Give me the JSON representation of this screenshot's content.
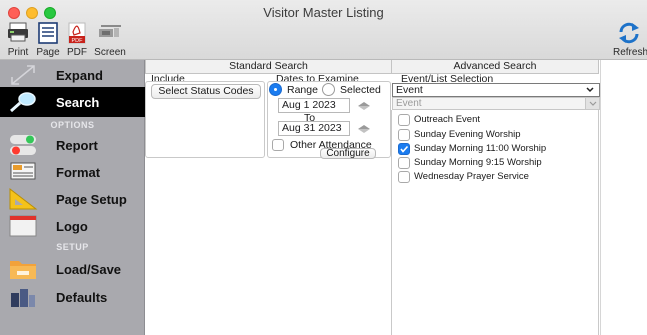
{
  "window": {
    "title": "Visitor Master Listing"
  },
  "toolbar": {
    "print": "Print",
    "page": "Page",
    "pdf": "PDF",
    "screen": "Screen",
    "refresh": "Refresh",
    "pdf_badge": "PDF"
  },
  "sidebar": {
    "expand": "Expand",
    "search": "Search",
    "options_head": "OPTIONS",
    "report": "Report",
    "format": "Format",
    "page_setup": "Page Setup",
    "logo": "Logo",
    "setup_head": "SETUP",
    "load_save": "Load/Save",
    "defaults": "Defaults"
  },
  "tabs": {
    "standard": "Standard Search",
    "advanced": "Advanced Search"
  },
  "include": {
    "label": "Include",
    "button": "Select Status Codes"
  },
  "dates": {
    "label": "Dates to Examine",
    "range": "Range",
    "selected": "Selected",
    "start": "Aug 1 2023",
    "to": "To",
    "end": "Aug 31 2023",
    "other_attendance": "Other Attendance",
    "configure": "Configure"
  },
  "event_selection": {
    "label": "Event/List Selection",
    "selected": "Event",
    "sub_value": "Event",
    "items": [
      {
        "label": "Outreach Event",
        "checked": false
      },
      {
        "label": "Sunday Evening Worship",
        "checked": false
      },
      {
        "label": "Sunday Morning 11:00 Worship",
        "checked": true
      },
      {
        "label": "Sunday Morning 9:15 Worship",
        "checked": false
      },
      {
        "label": "Wednesday Prayer Service",
        "checked": false
      }
    ]
  }
}
